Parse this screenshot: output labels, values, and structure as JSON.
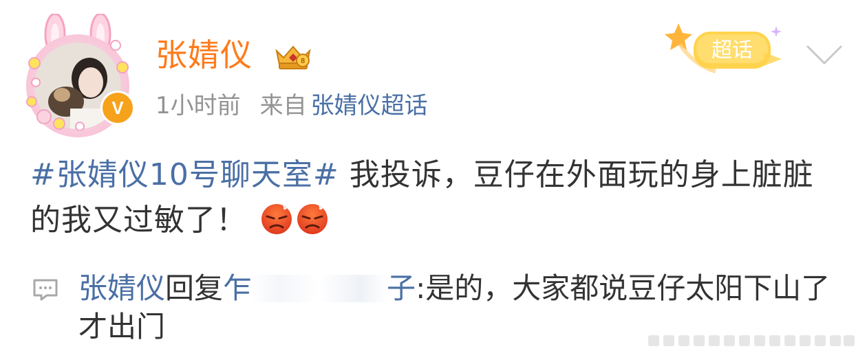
{
  "header": {
    "username": "张婧仪",
    "verified_symbol": "V",
    "time": "1小时前",
    "source_prefix": "来自",
    "source": "张婧仪超话",
    "supertopic_badge_label": "超话",
    "vip_icon": "crown-vip-icon",
    "menu_icon": "chevron-down-icon"
  },
  "post": {
    "hashtag": "#张婧仪10号聊天室#",
    "text": " 我投诉，豆仔在外面玩的身上脏脏的我又过敏了！",
    "emoji": [
      "angry-face-icon",
      "angry-face-icon"
    ]
  },
  "reply": {
    "icon": "comment-bubble-icon",
    "author": "张婧仪",
    "verb": "回复",
    "mention_visible_start": "乍",
    "mention_visible_end": "子",
    "text": ":是的，大家都说豆仔太阳下山了才出门"
  },
  "colors": {
    "username": "#ff7a1a",
    "link": "#4a6fa5",
    "meta": "#939393",
    "body": "#333333",
    "verified": "#f7a21b"
  }
}
